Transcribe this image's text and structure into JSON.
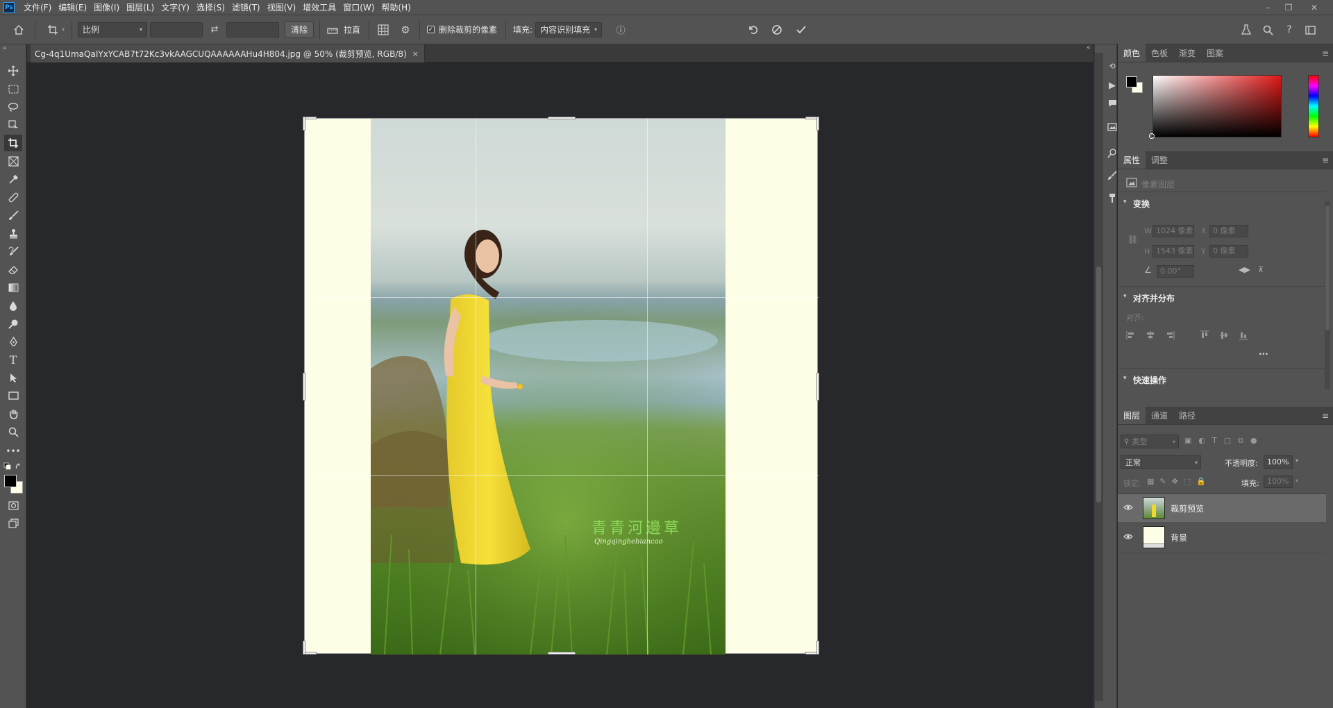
{
  "menubar": {
    "logo": "Ps",
    "items": [
      "文件(F)",
      "编辑(E)",
      "图像(I)",
      "图层(L)",
      "文字(Y)",
      "选择(S)",
      "滤镜(T)",
      "视图(V)",
      "增效工具",
      "窗口(W)",
      "帮助(H)"
    ],
    "window_controls": [
      "–",
      "❐",
      "✕"
    ]
  },
  "options": {
    "ratio_select": "比例",
    "clear_button": "清除",
    "straighten_label": "拉直",
    "delete_cropped_label": "删除裁剪的像素",
    "fill_label": "填充:",
    "fill_select": "内容识别填充"
  },
  "document": {
    "tab_title": "Cg-4q1UmaQaIYxYCAB7t72Kc3vkAAGCUQAAAAAAHu4H804.jpg @ 50% (裁剪预览, RGB/8)",
    "close": "×",
    "watermark_title": "青青河邊草",
    "watermark_subtitle": "Qingqinghebiancao"
  },
  "color_panel": {
    "tabs": [
      "颜色",
      "色板",
      "渐变",
      "图案"
    ],
    "active": 0,
    "menu": "≡"
  },
  "properties_panel": {
    "tabs": [
      "属性",
      "调整"
    ],
    "active": 0,
    "layer_type": "像素图层",
    "transform_title": "变换",
    "w_label": "W",
    "w_value": "1024 像素",
    "x_label": "X",
    "x_value": "0 像素",
    "h_label": "H",
    "h_value": "1543 像素",
    "y_label": "Y",
    "y_value": "0 像素",
    "angle_value": "0.00°",
    "align_title": "对齐并分布",
    "align_label": "对齐:",
    "more": "...",
    "quick_title": "快速操作"
  },
  "layers_panel": {
    "tabs": [
      "图层",
      "通道",
      "路径"
    ],
    "active": 0,
    "filter_placeholder": "类型",
    "blend_mode": "正常",
    "opacity_label": "不透明度:",
    "opacity_value": "100%",
    "lock_label": "锁定:",
    "fill_label": "填充:",
    "fill_value": "100%",
    "layers": [
      {
        "name": "裁剪预览",
        "selected": true
      },
      {
        "name": "背景",
        "selected": false
      }
    ]
  },
  "colors": {
    "accent": "#31a8ff",
    "canvas_fill": "#fefde6",
    "watermark": "#8bd85a"
  }
}
